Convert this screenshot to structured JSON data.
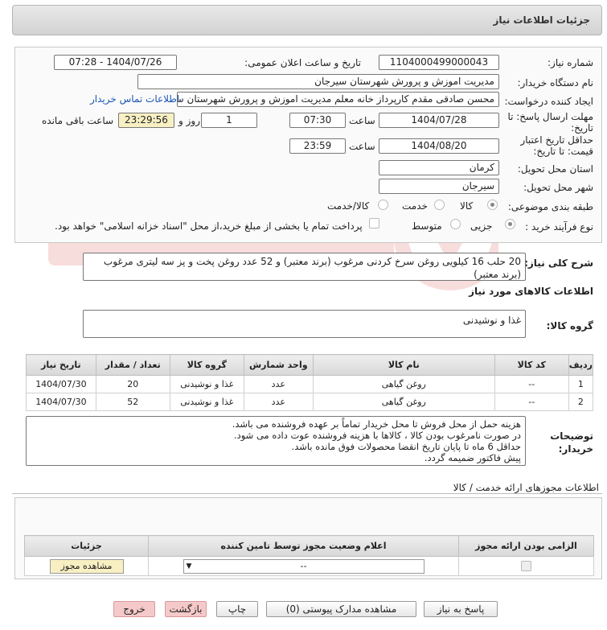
{
  "header": {
    "title": "جزئیات اطلاعات نیاز"
  },
  "form": {
    "need_number_label": "شماره نیاز:",
    "need_number": "1104000499000043",
    "announce_label": "تاریخ و ساعت اعلان عمومی:",
    "announce_value": "1404/07/26 - 07:28",
    "buyer_org_label": "نام دستگاه خریدار:",
    "buyer_org": "مدیریت اموزش و پرورش شهرستان سیرجان",
    "creator_label": "ایجاد کننده درخواست:",
    "creator": "محسن صادقی مقدم کارپرداز خانه معلم مدیریت اموزش و پرورش شهرستان سیر",
    "contact_link": "اطلاعات تماس خریدار",
    "deadline_label_1": "مهلت ارسال پاسخ: تا",
    "deadline_label_2": "تاریخ:",
    "deadline_date": "1404/07/28",
    "time_label": "ساعت",
    "deadline_time": "07:30",
    "days_value": "1",
    "days_label": "روز و",
    "remaining_time": "23:29:56",
    "remaining_label": "ساعت باقی مانده",
    "validity_label_1": "حداقل تاریخ اعتبار",
    "validity_label_2": "قیمت: تا تاریخ:",
    "validity_date": "1404/08/20",
    "validity_time": "23:59",
    "province_label": "استان محل تحویل:",
    "province": "کرمان",
    "city_label": "شهر محل تحویل:",
    "city": "سیرجان",
    "category_label": "طبقه بندی موضوعی:",
    "category_options": [
      "کالا",
      "خدمت",
      "کالا/خدمت"
    ],
    "process_label": "نوع فرآیند خرید :",
    "process_options": [
      "جزیی",
      "متوسط"
    ],
    "payment_note": "پرداخت تمام یا بخشی از مبلغ خرید،از محل \"اسناد خزانه اسلامی\" خواهد بود.",
    "summary_label": "شرح کلی نیاز:",
    "summary": "20 حلب 16 کیلویی روغن سرخ کردنی مرغوب (برند معتبر) و 52 عدد روغن پخت و پز سه لیتری مرغوب (برند معتبر)"
  },
  "goods": {
    "section_title": "اطلاعات کالاهای مورد نیاز",
    "group_label": "گروه کالا:",
    "group_value": "غذا و نوشیدنی",
    "columns": [
      "ردیف",
      "کد کالا",
      "نام کالا",
      "واحد شمارش",
      "گروه کالا",
      "تعداد / مقدار",
      "تاریخ نیاز"
    ],
    "rows": [
      [
        "1",
        "--",
        "روغن گیاهی",
        "عدد",
        "غذا و نوشیدنی",
        "20",
        "1404/07/30"
      ],
      [
        "2",
        "--",
        "روغن گیاهی",
        "عدد",
        "غذا و نوشیدنی",
        "52",
        "1404/07/30"
      ]
    ]
  },
  "buyer_notes": {
    "label_1": "توضیحات",
    "label_2": "خریدار:",
    "lines": [
      "هزینه حمل از محل فروش تا محل خریدار تماماً بر عهده فروشنده می باشد.",
      "در صورت نامرغوب بودن کالا ، کالاها با هزینه فروشنده عوت داده می شود.",
      "حداقل 6 ماه تا پایان تاریخ انقضا محصولات فوق مانده باشد.",
      "پیش فاکتور ضمیمه گردد."
    ]
  },
  "permits": {
    "section_title": "اطلاعات مجوزهای ارائه خدمت / کالا",
    "columns": [
      "الزامی بودن ارائه مجوز",
      "اعلام وضعیت مجوز توسط تامین کننده",
      "جزئیات"
    ],
    "select_value": "--",
    "view_button": "مشاهده مجوز"
  },
  "footer": {
    "reply": "پاسخ به نیاز",
    "attachments": "مشاهده مدارک پیوستی (0)",
    "print": "چاپ",
    "back": "بازگشت",
    "exit": "خروج"
  }
}
